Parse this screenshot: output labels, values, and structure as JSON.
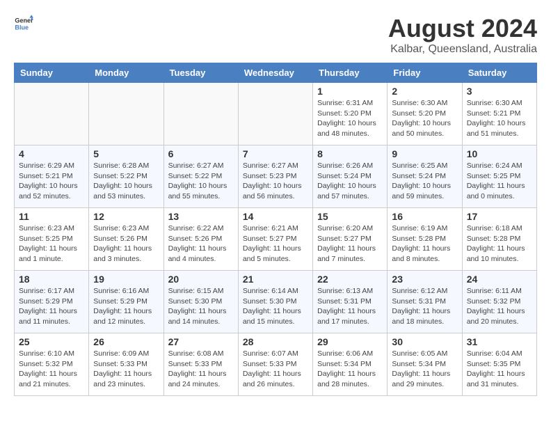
{
  "header": {
    "logo_general": "General",
    "logo_blue": "Blue",
    "month_title": "August 2024",
    "location": "Kalbar, Queensland, Australia"
  },
  "days_of_week": [
    "Sunday",
    "Monday",
    "Tuesday",
    "Wednesday",
    "Thursday",
    "Friday",
    "Saturday"
  ],
  "weeks": [
    [
      {
        "day": "",
        "info": ""
      },
      {
        "day": "",
        "info": ""
      },
      {
        "day": "",
        "info": ""
      },
      {
        "day": "",
        "info": ""
      },
      {
        "day": "1",
        "info": "Sunrise: 6:31 AM\nSunset: 5:20 PM\nDaylight: 10 hours\nand 48 minutes."
      },
      {
        "day": "2",
        "info": "Sunrise: 6:30 AM\nSunset: 5:20 PM\nDaylight: 10 hours\nand 50 minutes."
      },
      {
        "day": "3",
        "info": "Sunrise: 6:30 AM\nSunset: 5:21 PM\nDaylight: 10 hours\nand 51 minutes."
      }
    ],
    [
      {
        "day": "4",
        "info": "Sunrise: 6:29 AM\nSunset: 5:21 PM\nDaylight: 10 hours\nand 52 minutes."
      },
      {
        "day": "5",
        "info": "Sunrise: 6:28 AM\nSunset: 5:22 PM\nDaylight: 10 hours\nand 53 minutes."
      },
      {
        "day": "6",
        "info": "Sunrise: 6:27 AM\nSunset: 5:22 PM\nDaylight: 10 hours\nand 55 minutes."
      },
      {
        "day": "7",
        "info": "Sunrise: 6:27 AM\nSunset: 5:23 PM\nDaylight: 10 hours\nand 56 minutes."
      },
      {
        "day": "8",
        "info": "Sunrise: 6:26 AM\nSunset: 5:24 PM\nDaylight: 10 hours\nand 57 minutes."
      },
      {
        "day": "9",
        "info": "Sunrise: 6:25 AM\nSunset: 5:24 PM\nDaylight: 10 hours\nand 59 minutes."
      },
      {
        "day": "10",
        "info": "Sunrise: 6:24 AM\nSunset: 5:25 PM\nDaylight: 11 hours\nand 0 minutes."
      }
    ],
    [
      {
        "day": "11",
        "info": "Sunrise: 6:23 AM\nSunset: 5:25 PM\nDaylight: 11 hours\nand 1 minute."
      },
      {
        "day": "12",
        "info": "Sunrise: 6:23 AM\nSunset: 5:26 PM\nDaylight: 11 hours\nand 3 minutes."
      },
      {
        "day": "13",
        "info": "Sunrise: 6:22 AM\nSunset: 5:26 PM\nDaylight: 11 hours\nand 4 minutes."
      },
      {
        "day": "14",
        "info": "Sunrise: 6:21 AM\nSunset: 5:27 PM\nDaylight: 11 hours\nand 5 minutes."
      },
      {
        "day": "15",
        "info": "Sunrise: 6:20 AM\nSunset: 5:27 PM\nDaylight: 11 hours\nand 7 minutes."
      },
      {
        "day": "16",
        "info": "Sunrise: 6:19 AM\nSunset: 5:28 PM\nDaylight: 11 hours\nand 8 minutes."
      },
      {
        "day": "17",
        "info": "Sunrise: 6:18 AM\nSunset: 5:28 PM\nDaylight: 11 hours\nand 10 minutes."
      }
    ],
    [
      {
        "day": "18",
        "info": "Sunrise: 6:17 AM\nSunset: 5:29 PM\nDaylight: 11 hours\nand 11 minutes."
      },
      {
        "day": "19",
        "info": "Sunrise: 6:16 AM\nSunset: 5:29 PM\nDaylight: 11 hours\nand 12 minutes."
      },
      {
        "day": "20",
        "info": "Sunrise: 6:15 AM\nSunset: 5:30 PM\nDaylight: 11 hours\nand 14 minutes."
      },
      {
        "day": "21",
        "info": "Sunrise: 6:14 AM\nSunset: 5:30 PM\nDaylight: 11 hours\nand 15 minutes."
      },
      {
        "day": "22",
        "info": "Sunrise: 6:13 AM\nSunset: 5:31 PM\nDaylight: 11 hours\nand 17 minutes."
      },
      {
        "day": "23",
        "info": "Sunrise: 6:12 AM\nSunset: 5:31 PM\nDaylight: 11 hours\nand 18 minutes."
      },
      {
        "day": "24",
        "info": "Sunrise: 6:11 AM\nSunset: 5:32 PM\nDaylight: 11 hours\nand 20 minutes."
      }
    ],
    [
      {
        "day": "25",
        "info": "Sunrise: 6:10 AM\nSunset: 5:32 PM\nDaylight: 11 hours\nand 21 minutes."
      },
      {
        "day": "26",
        "info": "Sunrise: 6:09 AM\nSunset: 5:33 PM\nDaylight: 11 hours\nand 23 minutes."
      },
      {
        "day": "27",
        "info": "Sunrise: 6:08 AM\nSunset: 5:33 PM\nDaylight: 11 hours\nand 24 minutes."
      },
      {
        "day": "28",
        "info": "Sunrise: 6:07 AM\nSunset: 5:33 PM\nDaylight: 11 hours\nand 26 minutes."
      },
      {
        "day": "29",
        "info": "Sunrise: 6:06 AM\nSunset: 5:34 PM\nDaylight: 11 hours\nand 28 minutes."
      },
      {
        "day": "30",
        "info": "Sunrise: 6:05 AM\nSunset: 5:34 PM\nDaylight: 11 hours\nand 29 minutes."
      },
      {
        "day": "31",
        "info": "Sunrise: 6:04 AM\nSunset: 5:35 PM\nDaylight: 11 hours\nand 31 minutes."
      }
    ]
  ]
}
